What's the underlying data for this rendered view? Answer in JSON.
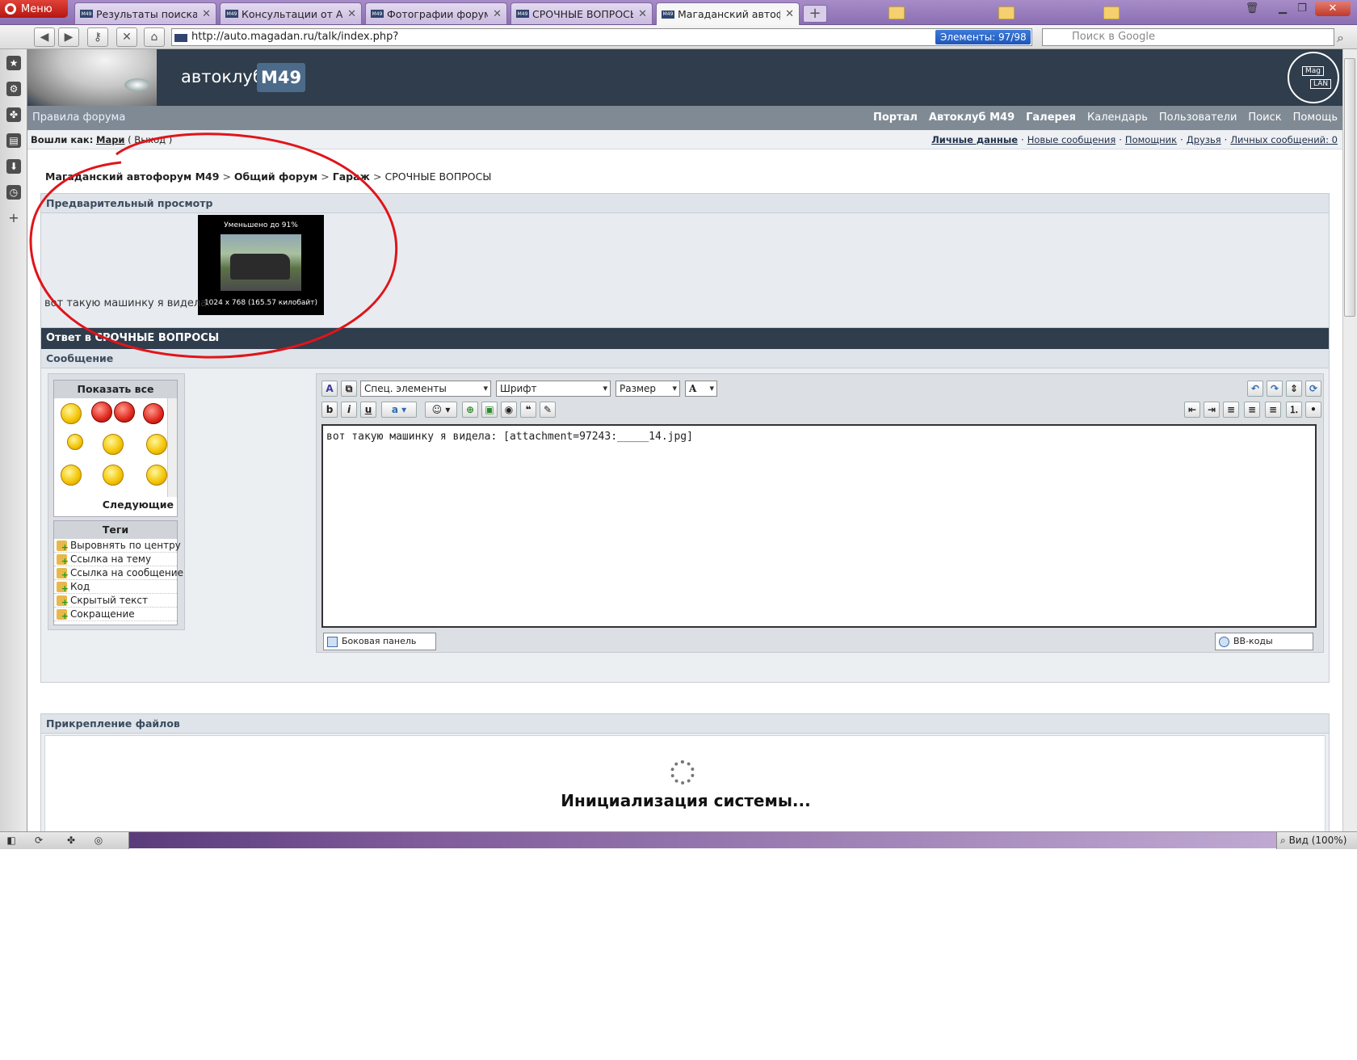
{
  "browser": {
    "menu_label": "Меню",
    "tabs": [
      {
        "title": "Результаты поиска"
      },
      {
        "title": "Консультации от Авто..."
      },
      {
        "title": "Фотографии форумч..."
      },
      {
        "title": "СРОЧНЫЕ ВОПРОСЫ ..."
      },
      {
        "title": "Магаданский автофо..."
      }
    ],
    "new_tab": "+",
    "url": "http://auto.magadan.ru/talk/index.php?",
    "elements_badge": "Элементы:   97/98",
    "search_placeholder": "Поиск в Google",
    "zoom_label": "Вид (100%)"
  },
  "forum": {
    "brand": "автоклуб",
    "badge": "M49",
    "logo_text_1": "Mag",
    "logo_text_2": "LAN",
    "rules": "Правила форума",
    "nav": [
      "Портал",
      "Автоклуб М49",
      "Галерея",
      "Календарь",
      "Пользователи",
      "Поиск",
      "Помощь"
    ],
    "user": {
      "logged_as": "Вошли как:",
      "name": "Мари",
      "logout": "( Выход )"
    },
    "user_links": [
      "Личные данные",
      "Новые сообщения",
      "Помощник",
      "Друзья",
      "Личных сообщений: 0"
    ],
    "breadcrumb": [
      "Магаданский автофорум М49",
      "Общий форум",
      "Гараж",
      "СРОЧНЫЕ ВОПРОСЫ"
    ],
    "breadcrumb_sep": ">",
    "preview": {
      "header": "Предварительный просмотр",
      "text": "вот такую машинку я видела:",
      "thumb_top": "Уменьшено до 91%",
      "thumb_caption": "1024 x 768 (165.57 килобайт)"
    },
    "reply": {
      "title": "Ответ в СРОЧНЫЕ ВОПРОСЫ",
      "message_header": "Сообщение",
      "smilies_header": "Показать все",
      "smilies_next": "Следующие",
      "tags_header": "Теги",
      "tags": [
        "Выровнять по центру",
        "Ссылка на тему",
        "Ссылка на сообщение",
        "Код",
        "Скрытый текст",
        "Сокращение"
      ],
      "special_select": "Спец. элементы",
      "font_select": "Шрифт",
      "size_select": "Размер",
      "editor_text": "вот такую машинку я видела: [attachment=97243:_____14.jpg]",
      "side_panel_btn": "Боковая панель",
      "bbcodes_btn": "BB-коды"
    },
    "attach": {
      "header": "Прикрепление файлов",
      "status": "Инициализация системы..."
    }
  },
  "colors": {
    "header_dark": "#2f3d4c",
    "nav_grey": "#7f8a94",
    "annotation_red": "#e0141a"
  }
}
